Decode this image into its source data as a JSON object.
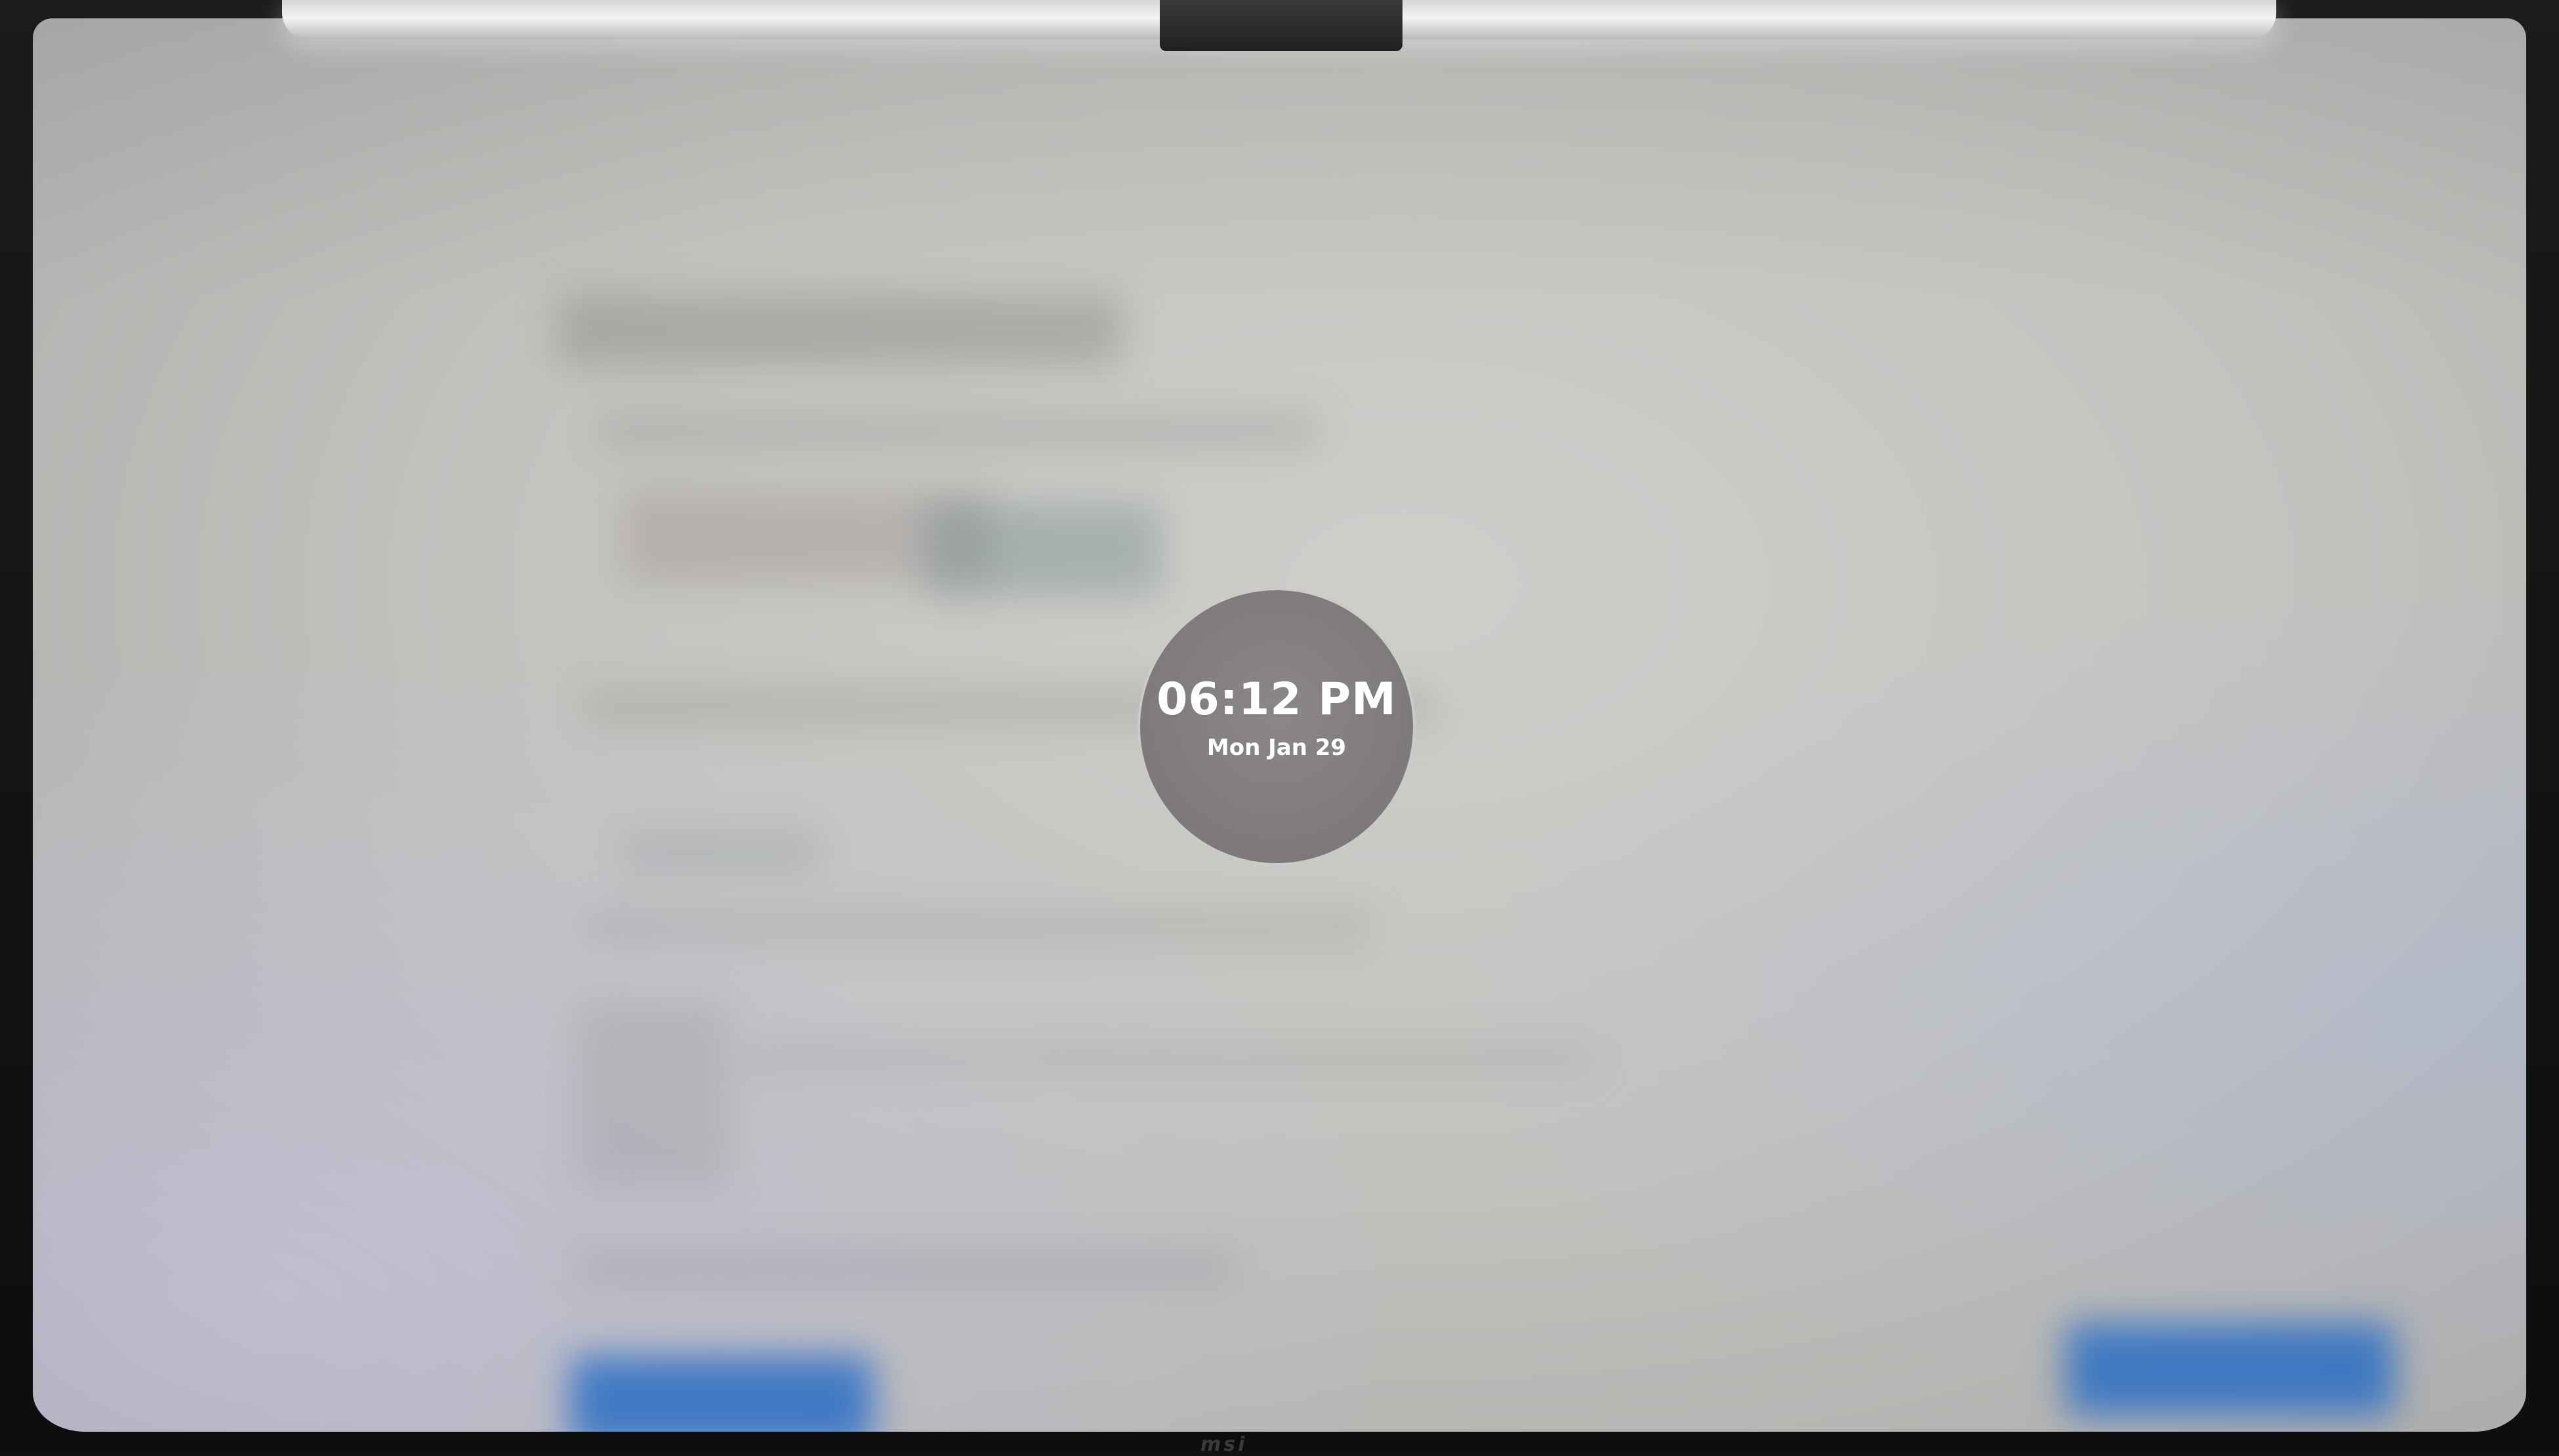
{
  "lock_screen": {
    "time": "06:12 PM",
    "date": "Mon Jan 29"
  },
  "device": {
    "brand": "msi"
  },
  "colors": {
    "screen_bg": "#c4c3c0",
    "dial_bg": "#7d7a79",
    "dial_border": "#e6e6e6",
    "text": "#ffffff",
    "blurred_button_blue": "#2a6fc4"
  }
}
